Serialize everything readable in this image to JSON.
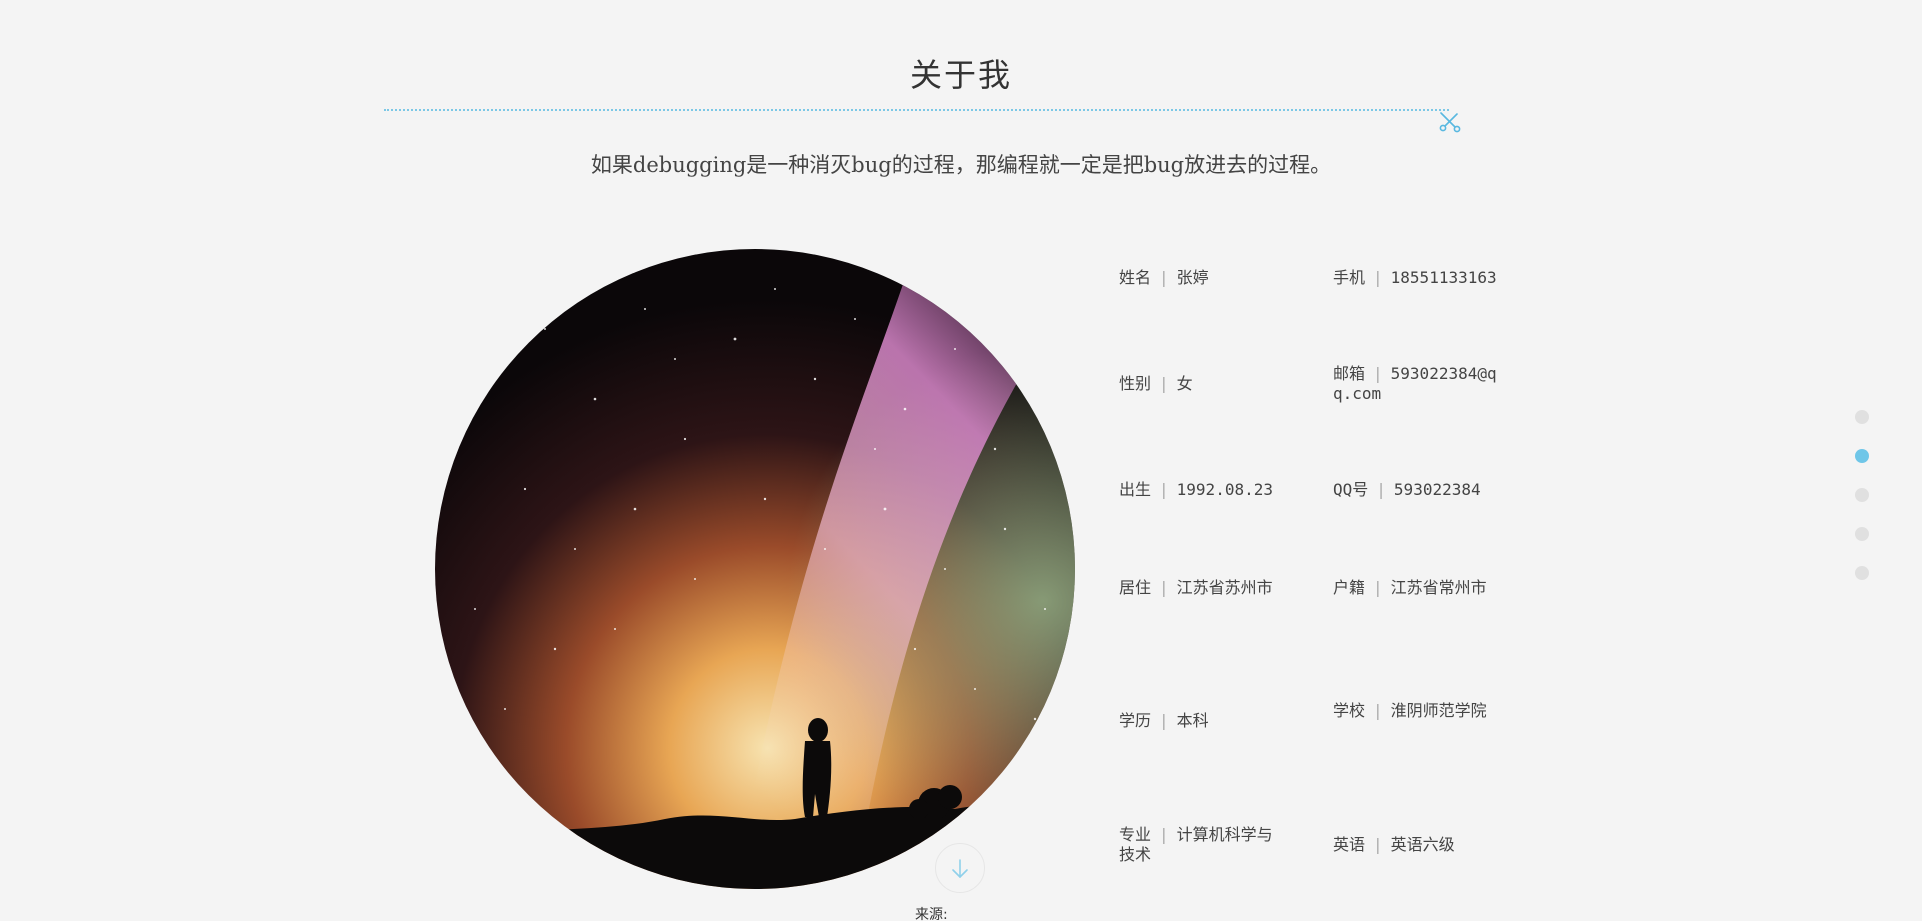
{
  "section": {
    "title": "关于我",
    "motto": "如果debugging是一种消灭bug的过程，那编程就一定是把bug放进去的过程。"
  },
  "info": [
    {
      "label": "姓名",
      "value": "张婷"
    },
    {
      "label": "手机",
      "value": "18551133163"
    },
    {
      "label": "性别",
      "value": "女"
    },
    {
      "label": "邮箱",
      "value": "593022384@qq.com"
    },
    {
      "label": "出生",
      "value": "1992.08.23"
    },
    {
      "label": "QQ号",
      "value": "593022384"
    },
    {
      "label": "居住",
      "value": "江苏省苏州市"
    },
    {
      "label": "户籍",
      "value": "江苏省常州市"
    },
    {
      "label": "学历",
      "value": "本科"
    },
    {
      "label": "学校",
      "value": "淮阴师范学院"
    },
    {
      "label": "专业",
      "value": "计算机科学与技术"
    },
    {
      "label": "英语",
      "value": "英语六级"
    }
  ],
  "separator": "|",
  "footer": {
    "source": "来源:"
  },
  "nav": {
    "dot_count": 5,
    "active_index": 1
  },
  "colors": {
    "accent": "#6fc6e8",
    "background": "#f4f4f4",
    "text": "#444444"
  },
  "icons": {
    "divider_end": "scissor-icon",
    "scroll": "arrow-down-icon"
  }
}
